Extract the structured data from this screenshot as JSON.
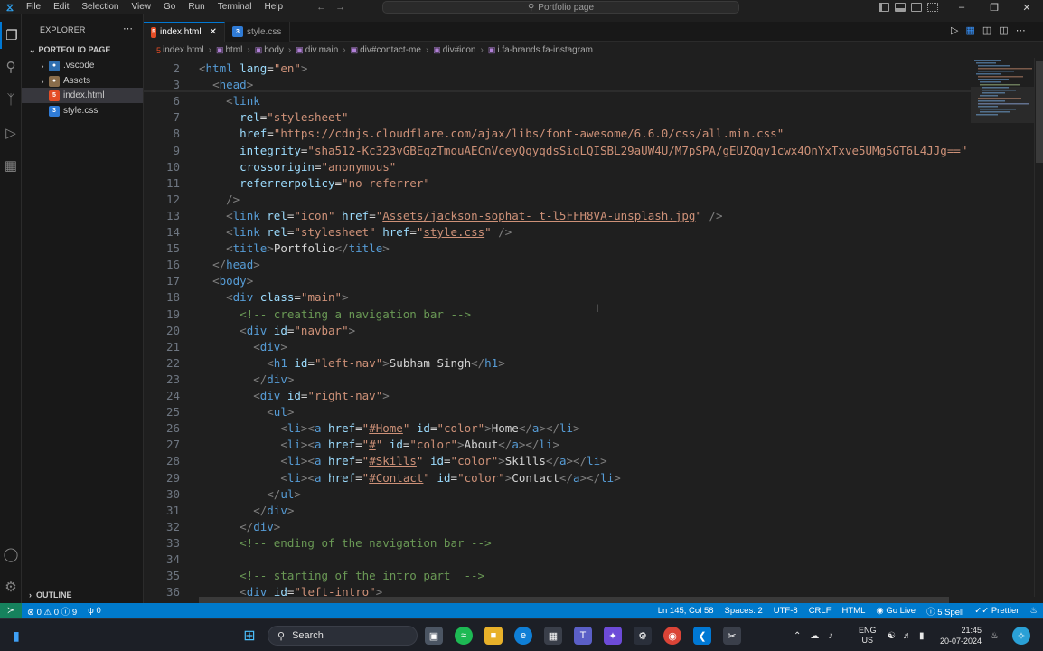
{
  "titlebar": {
    "menu": [
      "File",
      "Edit",
      "Selection",
      "View",
      "Go",
      "Run",
      "Terminal",
      "Help"
    ],
    "command_center": "Portfolio page"
  },
  "sidebar": {
    "header": "EXPLORER",
    "root": "PORTFOLIO PAGE",
    "items": [
      {
        "label": ".vscode",
        "type": "folder"
      },
      {
        "label": "Assets",
        "type": "folder"
      },
      {
        "label": "index.html",
        "type": "html"
      },
      {
        "label": "style.css",
        "type": "css"
      }
    ],
    "outline": "OUTLINE"
  },
  "tabs": [
    {
      "label": "index.html",
      "active": true
    },
    {
      "label": "style.css",
      "active": false
    }
  ],
  "breadcrumb": [
    "index.html",
    "html",
    "body",
    "div.main",
    "div#contact-me",
    "div#icon",
    "i.fa-brands.fa-instagram"
  ],
  "editor": {
    "line_numbers": [
      "2",
      "3",
      "6",
      "7",
      "8",
      "9",
      "10",
      "11",
      "12",
      "13",
      "14",
      "15",
      "16",
      "17",
      "18",
      "19",
      "20",
      "21",
      "22",
      "23",
      "24",
      "25",
      "26",
      "27",
      "28",
      "29",
      "30",
      "31",
      "32",
      "33",
      "34",
      "35",
      "36"
    ],
    "lines": [
      [
        {
          "c": "br",
          "t": "<"
        },
        {
          "c": "tg",
          "t": "html"
        },
        {
          "c": "tx",
          "t": " "
        },
        {
          "c": "at",
          "t": "lang"
        },
        {
          "c": "tx",
          "t": "="
        },
        {
          "c": "st",
          "t": "\"en\""
        },
        {
          "c": "br",
          "t": ">"
        }
      ],
      [
        {
          "c": "tx",
          "t": "  "
        },
        {
          "c": "br",
          "t": "<"
        },
        {
          "c": "tg",
          "t": "head"
        },
        {
          "c": "br",
          "t": ">"
        }
      ],
      [
        {
          "c": "tx",
          "t": "    "
        },
        {
          "c": "br",
          "t": "<"
        },
        {
          "c": "tg",
          "t": "link"
        }
      ],
      [
        {
          "c": "tx",
          "t": "      "
        },
        {
          "c": "at",
          "t": "rel"
        },
        {
          "c": "tx",
          "t": "="
        },
        {
          "c": "st",
          "t": "\"stylesheet\""
        }
      ],
      [
        {
          "c": "tx",
          "t": "      "
        },
        {
          "c": "at",
          "t": "href"
        },
        {
          "c": "tx",
          "t": "="
        },
        {
          "c": "st",
          "t": "\"https://cdnjs.cloudflare.com/ajax/libs/font-awesome/6.6.0/css/all.min.css\""
        }
      ],
      [
        {
          "c": "tx",
          "t": "      "
        },
        {
          "c": "at",
          "t": "integrity"
        },
        {
          "c": "tx",
          "t": "="
        },
        {
          "c": "st",
          "t": "\"sha512-Kc323vGBEqzTmouAECnVceyQqyqdsSiqLQISBL29aUW4U/M7pSPA/gEUZQqv1cwx4OnYxTxve5UMg5GT6L4JJg==\""
        }
      ],
      [
        {
          "c": "tx",
          "t": "      "
        },
        {
          "c": "at",
          "t": "crossorigin"
        },
        {
          "c": "tx",
          "t": "="
        },
        {
          "c": "st",
          "t": "\"anonymous\""
        }
      ],
      [
        {
          "c": "tx",
          "t": "      "
        },
        {
          "c": "at",
          "t": "referrerpolicy"
        },
        {
          "c": "tx",
          "t": "="
        },
        {
          "c": "st",
          "t": "\"no-referrer\""
        }
      ],
      [
        {
          "c": "tx",
          "t": "    "
        },
        {
          "c": "br",
          "t": "/>"
        }
      ],
      [
        {
          "c": "tx",
          "t": "    "
        },
        {
          "c": "br",
          "t": "<"
        },
        {
          "c": "tg",
          "t": "link"
        },
        {
          "c": "tx",
          "t": " "
        },
        {
          "c": "at",
          "t": "rel"
        },
        {
          "c": "tx",
          "t": "="
        },
        {
          "c": "st",
          "t": "\"icon\""
        },
        {
          "c": "tx",
          "t": " "
        },
        {
          "c": "at",
          "t": "href"
        },
        {
          "c": "tx",
          "t": "="
        },
        {
          "c": "st",
          "t": "\""
        },
        {
          "c": "st ul",
          "t": "Assets/jackson-sophat-_t-l5FFH8VA-unsplash.jpg"
        },
        {
          "c": "st",
          "t": "\""
        },
        {
          "c": "tx",
          "t": " "
        },
        {
          "c": "br",
          "t": "/>"
        }
      ],
      [
        {
          "c": "tx",
          "t": "    "
        },
        {
          "c": "br",
          "t": "<"
        },
        {
          "c": "tg",
          "t": "link"
        },
        {
          "c": "tx",
          "t": " "
        },
        {
          "c": "at",
          "t": "rel"
        },
        {
          "c": "tx",
          "t": "="
        },
        {
          "c": "st",
          "t": "\"stylesheet\""
        },
        {
          "c": "tx",
          "t": " "
        },
        {
          "c": "at",
          "t": "href"
        },
        {
          "c": "tx",
          "t": "="
        },
        {
          "c": "st",
          "t": "\""
        },
        {
          "c": "st ul",
          "t": "style.css"
        },
        {
          "c": "st",
          "t": "\""
        },
        {
          "c": "tx",
          "t": " "
        },
        {
          "c": "br",
          "t": "/>"
        }
      ],
      [
        {
          "c": "tx",
          "t": "    "
        },
        {
          "c": "br",
          "t": "<"
        },
        {
          "c": "tg",
          "t": "title"
        },
        {
          "c": "br",
          "t": ">"
        },
        {
          "c": "tx",
          "t": "Portfolio"
        },
        {
          "c": "br",
          "t": "</"
        },
        {
          "c": "tg",
          "t": "title"
        },
        {
          "c": "br",
          "t": ">"
        }
      ],
      [
        {
          "c": "tx",
          "t": "  "
        },
        {
          "c": "br",
          "t": "</"
        },
        {
          "c": "tg",
          "t": "head"
        },
        {
          "c": "br",
          "t": ">"
        }
      ],
      [
        {
          "c": "tx",
          "t": "  "
        },
        {
          "c": "br",
          "t": "<"
        },
        {
          "c": "tg",
          "t": "body"
        },
        {
          "c": "br",
          "t": ">"
        }
      ],
      [
        {
          "c": "tx",
          "t": "    "
        },
        {
          "c": "br",
          "t": "<"
        },
        {
          "c": "tg",
          "t": "div"
        },
        {
          "c": "tx",
          "t": " "
        },
        {
          "c": "at",
          "t": "class"
        },
        {
          "c": "tx",
          "t": "="
        },
        {
          "c": "st",
          "t": "\"main\""
        },
        {
          "c": "br",
          "t": ">"
        }
      ],
      [
        {
          "c": "tx",
          "t": "      "
        },
        {
          "c": "cm",
          "t": "<!-- creating a navigation bar -->"
        }
      ],
      [
        {
          "c": "tx",
          "t": "      "
        },
        {
          "c": "br",
          "t": "<"
        },
        {
          "c": "tg",
          "t": "div"
        },
        {
          "c": "tx",
          "t": " "
        },
        {
          "c": "at",
          "t": "id"
        },
        {
          "c": "tx",
          "t": "="
        },
        {
          "c": "st",
          "t": "\"navbar\""
        },
        {
          "c": "br",
          "t": ">"
        }
      ],
      [
        {
          "c": "tx",
          "t": "        "
        },
        {
          "c": "br",
          "t": "<"
        },
        {
          "c": "tg",
          "t": "div"
        },
        {
          "c": "br",
          "t": ">"
        }
      ],
      [
        {
          "c": "tx",
          "t": "          "
        },
        {
          "c": "br",
          "t": "<"
        },
        {
          "c": "tg",
          "t": "h1"
        },
        {
          "c": "tx",
          "t": " "
        },
        {
          "c": "at",
          "t": "id"
        },
        {
          "c": "tx",
          "t": "="
        },
        {
          "c": "st",
          "t": "\"left-nav\""
        },
        {
          "c": "br",
          "t": ">"
        },
        {
          "c": "tx",
          "t": "Subham Singh"
        },
        {
          "c": "br",
          "t": "</"
        },
        {
          "c": "tg",
          "t": "h1"
        },
        {
          "c": "br",
          "t": ">"
        }
      ],
      [
        {
          "c": "tx",
          "t": "        "
        },
        {
          "c": "br",
          "t": "</"
        },
        {
          "c": "tg",
          "t": "div"
        },
        {
          "c": "br",
          "t": ">"
        }
      ],
      [
        {
          "c": "tx",
          "t": "        "
        },
        {
          "c": "br",
          "t": "<"
        },
        {
          "c": "tg",
          "t": "div"
        },
        {
          "c": "tx",
          "t": " "
        },
        {
          "c": "at",
          "t": "id"
        },
        {
          "c": "tx",
          "t": "="
        },
        {
          "c": "st",
          "t": "\"right-nav\""
        },
        {
          "c": "br",
          "t": ">"
        }
      ],
      [
        {
          "c": "tx",
          "t": "          "
        },
        {
          "c": "br",
          "t": "<"
        },
        {
          "c": "tg",
          "t": "ul"
        },
        {
          "c": "br",
          "t": ">"
        }
      ],
      [
        {
          "c": "tx",
          "t": "            "
        },
        {
          "c": "br",
          "t": "<"
        },
        {
          "c": "tg",
          "t": "li"
        },
        {
          "c": "br",
          "t": "><"
        },
        {
          "c": "tg",
          "t": "a"
        },
        {
          "c": "tx",
          "t": " "
        },
        {
          "c": "at",
          "t": "href"
        },
        {
          "c": "tx",
          "t": "="
        },
        {
          "c": "st",
          "t": "\""
        },
        {
          "c": "st ul",
          "t": "#Home"
        },
        {
          "c": "st",
          "t": "\""
        },
        {
          "c": "tx",
          "t": " "
        },
        {
          "c": "at",
          "t": "id"
        },
        {
          "c": "tx",
          "t": "="
        },
        {
          "c": "st",
          "t": "\"color\""
        },
        {
          "c": "br",
          "t": ">"
        },
        {
          "c": "tx",
          "t": "Home"
        },
        {
          "c": "br",
          "t": "</"
        },
        {
          "c": "tg",
          "t": "a"
        },
        {
          "c": "br",
          "t": "></"
        },
        {
          "c": "tg",
          "t": "li"
        },
        {
          "c": "br",
          "t": ">"
        }
      ],
      [
        {
          "c": "tx",
          "t": "            "
        },
        {
          "c": "br",
          "t": "<"
        },
        {
          "c": "tg",
          "t": "li"
        },
        {
          "c": "br",
          "t": "><"
        },
        {
          "c": "tg",
          "t": "a"
        },
        {
          "c": "tx",
          "t": " "
        },
        {
          "c": "at",
          "t": "href"
        },
        {
          "c": "tx",
          "t": "="
        },
        {
          "c": "st",
          "t": "\""
        },
        {
          "c": "st ul",
          "t": "#"
        },
        {
          "c": "st",
          "t": "\""
        },
        {
          "c": "tx",
          "t": " "
        },
        {
          "c": "at",
          "t": "id"
        },
        {
          "c": "tx",
          "t": "="
        },
        {
          "c": "st",
          "t": "\"color\""
        },
        {
          "c": "br",
          "t": ">"
        },
        {
          "c": "tx",
          "t": "About"
        },
        {
          "c": "br",
          "t": "</"
        },
        {
          "c": "tg",
          "t": "a"
        },
        {
          "c": "br",
          "t": "></"
        },
        {
          "c": "tg",
          "t": "li"
        },
        {
          "c": "br",
          "t": ">"
        }
      ],
      [
        {
          "c": "tx",
          "t": "            "
        },
        {
          "c": "br",
          "t": "<"
        },
        {
          "c": "tg",
          "t": "li"
        },
        {
          "c": "br",
          "t": "><"
        },
        {
          "c": "tg",
          "t": "a"
        },
        {
          "c": "tx",
          "t": " "
        },
        {
          "c": "at",
          "t": "href"
        },
        {
          "c": "tx",
          "t": "="
        },
        {
          "c": "st",
          "t": "\""
        },
        {
          "c": "st ul",
          "t": "#Skills"
        },
        {
          "c": "st",
          "t": "\""
        },
        {
          "c": "tx",
          "t": " "
        },
        {
          "c": "at",
          "t": "id"
        },
        {
          "c": "tx",
          "t": "="
        },
        {
          "c": "st",
          "t": "\"color\""
        },
        {
          "c": "br",
          "t": ">"
        },
        {
          "c": "tx",
          "t": "Skills"
        },
        {
          "c": "br",
          "t": "</"
        },
        {
          "c": "tg",
          "t": "a"
        },
        {
          "c": "br",
          "t": "></"
        },
        {
          "c": "tg",
          "t": "li"
        },
        {
          "c": "br",
          "t": ">"
        }
      ],
      [
        {
          "c": "tx",
          "t": "            "
        },
        {
          "c": "br",
          "t": "<"
        },
        {
          "c": "tg",
          "t": "li"
        },
        {
          "c": "br",
          "t": "><"
        },
        {
          "c": "tg",
          "t": "a"
        },
        {
          "c": "tx",
          "t": " "
        },
        {
          "c": "at",
          "t": "href"
        },
        {
          "c": "tx",
          "t": "="
        },
        {
          "c": "st",
          "t": "\""
        },
        {
          "c": "st ul",
          "t": "#Contact"
        },
        {
          "c": "st",
          "t": "\""
        },
        {
          "c": "tx",
          "t": " "
        },
        {
          "c": "at",
          "t": "id"
        },
        {
          "c": "tx",
          "t": "="
        },
        {
          "c": "st",
          "t": "\"color\""
        },
        {
          "c": "br",
          "t": ">"
        },
        {
          "c": "tx",
          "t": "Contact"
        },
        {
          "c": "br",
          "t": "</"
        },
        {
          "c": "tg",
          "t": "a"
        },
        {
          "c": "br",
          "t": "></"
        },
        {
          "c": "tg",
          "t": "li"
        },
        {
          "c": "br",
          "t": ">"
        }
      ],
      [
        {
          "c": "tx",
          "t": "          "
        },
        {
          "c": "br",
          "t": "</"
        },
        {
          "c": "tg",
          "t": "ul"
        },
        {
          "c": "br",
          "t": ">"
        }
      ],
      [
        {
          "c": "tx",
          "t": "        "
        },
        {
          "c": "br",
          "t": "</"
        },
        {
          "c": "tg",
          "t": "div"
        },
        {
          "c": "br",
          "t": ">"
        }
      ],
      [
        {
          "c": "tx",
          "t": "      "
        },
        {
          "c": "br",
          "t": "</"
        },
        {
          "c": "tg",
          "t": "div"
        },
        {
          "c": "br",
          "t": ">"
        }
      ],
      [
        {
          "c": "tx",
          "t": "      "
        },
        {
          "c": "cm",
          "t": "<!-- ending of the navigation bar -->"
        }
      ],
      [
        {
          "c": "tx",
          "t": ""
        }
      ],
      [
        {
          "c": "tx",
          "t": "      "
        },
        {
          "c": "cm",
          "t": "<!-- starting of the intro part  -->"
        }
      ],
      [
        {
          "c": "tx",
          "t": "      "
        },
        {
          "c": "br",
          "t": "<"
        },
        {
          "c": "tg",
          "t": "div"
        },
        {
          "c": "tx",
          "t": " "
        },
        {
          "c": "at",
          "t": "id"
        },
        {
          "c": "tx",
          "t": "="
        },
        {
          "c": "st",
          "t": "\"left-intro\""
        },
        {
          "c": "br",
          "t": ">"
        }
      ]
    ]
  },
  "statusbar": {
    "problems": "0",
    "warnings": "0",
    "info": "9",
    "ports": "0",
    "position": "Ln 145, Col 58",
    "spaces": "Spaces: 2",
    "encoding": "UTF-8",
    "eol": "CRLF",
    "language": "HTML",
    "golive": "Go Live",
    "spell": "5 Spell",
    "prettier": "Prettier"
  },
  "taskbar": {
    "search": "Search",
    "lang_top": "ENG",
    "lang_bottom": "US",
    "time": "21:45",
    "date": "20-07-2024"
  },
  "colors": {
    "accent": "#0078d4",
    "statusbar": "#007acc",
    "remote": "#16825d"
  }
}
